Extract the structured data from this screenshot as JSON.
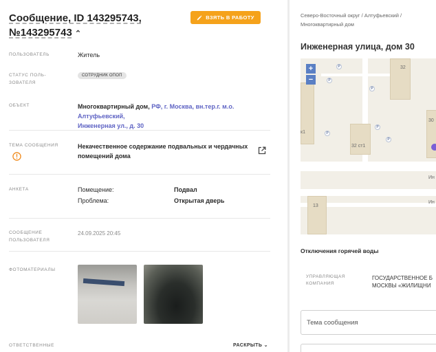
{
  "header": {
    "title_line1": "Сообщение, ID 143295743,",
    "title_line2": "№143295743",
    "work_button": "ВЗЯТЬ В РАБОТУ"
  },
  "fields": {
    "user_label": "ПОЛЬЗОВАТЕЛЬ",
    "user_value": "Житель",
    "status_label_1": "СТАТУС ПОЛЬ-",
    "status_label_2": "ЗОВАТЕЛЯ",
    "status_value": "СОТРУДНИК ОПОП",
    "object_label": "ОБЪЕКТ",
    "object_value": "Многоквартирный дом,",
    "object_link_1": "РФ, г. Москва, вн.тер.г. м.о. Алтуфьевский,",
    "object_link_2": "Инженерная ул., д. 30",
    "topic_label": "ТЕМА СООБЩЕНИЯ",
    "topic_value_1": "Некачественное содержание подвальных и чердачных",
    "topic_value_2": "помещений дома",
    "survey_label": "АНКЕТА",
    "survey_rows": [
      {
        "key": "Помещение:",
        "value": "Подвал"
      },
      {
        "key": "Проблема:",
        "value": "Открытая дверь"
      }
    ],
    "msg_label_1": "СООБЩЕНИЕ",
    "msg_label_2": "ПОЛЬЗОВАТЕЛЯ",
    "msg_value": "24.09.2025 20:45",
    "photos_label": "ФОТОМАТЕРИАЛЫ",
    "resp_label": "ОТВЕТСТВЕННЫЕ",
    "expand_label": "РАСКРЫТЬ"
  },
  "right": {
    "breadcrumb_1": "Северо-Восточный округ / Алтуфьевский /",
    "breadcrumb_2": "Многоквартирный дом",
    "address": "Инженерная улица, дом 30",
    "map": {
      "zoom_in": "+",
      "zoom_out": "−",
      "labels": [
        "32",
        "30",
        "к1",
        "32 ст1",
        "13",
        "Ин",
        "Ин"
      ],
      "pins": [
        "P",
        "P",
        "P",
        "P",
        "P",
        "P"
      ]
    },
    "section_title": "Отключения горячей воды",
    "uk_label_1": "УПРАВЛЯЮЩАЯ",
    "uk_label_2": "КОМПАНИЯ",
    "uk_value_1": "ГОСУДАРСТВЕННОЕ Б",
    "uk_value_2": "МОСКВЫ «ЖИЛИЩНИ",
    "subject_placeholder": "Тема сообщения"
  },
  "colors": {
    "accent_orange": "#f5a21b",
    "link_purple": "#5f64c4",
    "warning_orange": "#f08a1c",
    "map_control_blue": "#5a7fc4"
  }
}
